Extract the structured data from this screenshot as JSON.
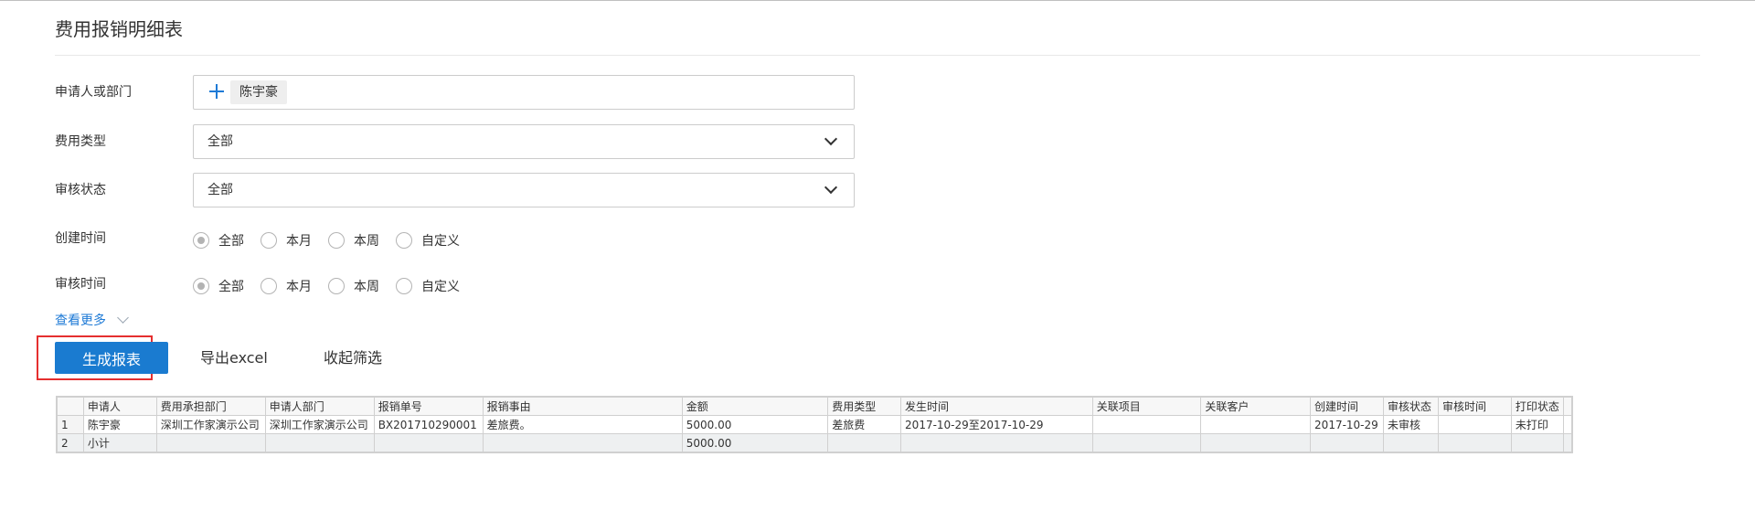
{
  "page": {
    "title": "费用报销明细表"
  },
  "filters": {
    "applicant": {
      "label": "申请人或部门",
      "tag": "陈宇豪"
    },
    "expense_type": {
      "label": "费用类型",
      "value": "全部"
    },
    "review_status": {
      "label": "审核状态",
      "value": "全部"
    },
    "created_time": {
      "label": "创建时间",
      "options": [
        "全部",
        "本月",
        "本周",
        "自定义"
      ],
      "selected": "全部"
    },
    "review_time": {
      "label": "审核时间",
      "options": [
        "全部",
        "本月",
        "本周",
        "自定义"
      ],
      "selected": "全部"
    },
    "more_label": "查看更多"
  },
  "actions": {
    "generate": "生成报表",
    "export": "导出excel",
    "collapse": "收起筛选"
  },
  "table": {
    "headers": [
      "申请人",
      "费用承担部门",
      "申请人部门",
      "报销单号",
      "报销事由",
      "金额",
      "费用类型",
      "发生时间",
      "关联项目",
      "关联客户",
      "创建时间",
      "审核状态",
      "审核时间",
      "打印状态"
    ],
    "rows": [
      {
        "num": "1",
        "cells": [
          "陈宇豪",
          "深圳工作家演示公司",
          "深圳工作家演示公司",
          "BX201710290001",
          "差旅费。",
          "5000.00",
          "差旅费",
          "2017-10-29至2017-10-29",
          "",
          "",
          "2017-10-29",
          "未审核",
          "",
          "未打印"
        ]
      }
    ],
    "subtotal": {
      "num": "2",
      "label": "小计",
      "amount": "5000.00"
    }
  },
  "colors": {
    "primary": "#1a7bd0",
    "link": "#1e7ad6",
    "highlight": "#e52f2f"
  }
}
